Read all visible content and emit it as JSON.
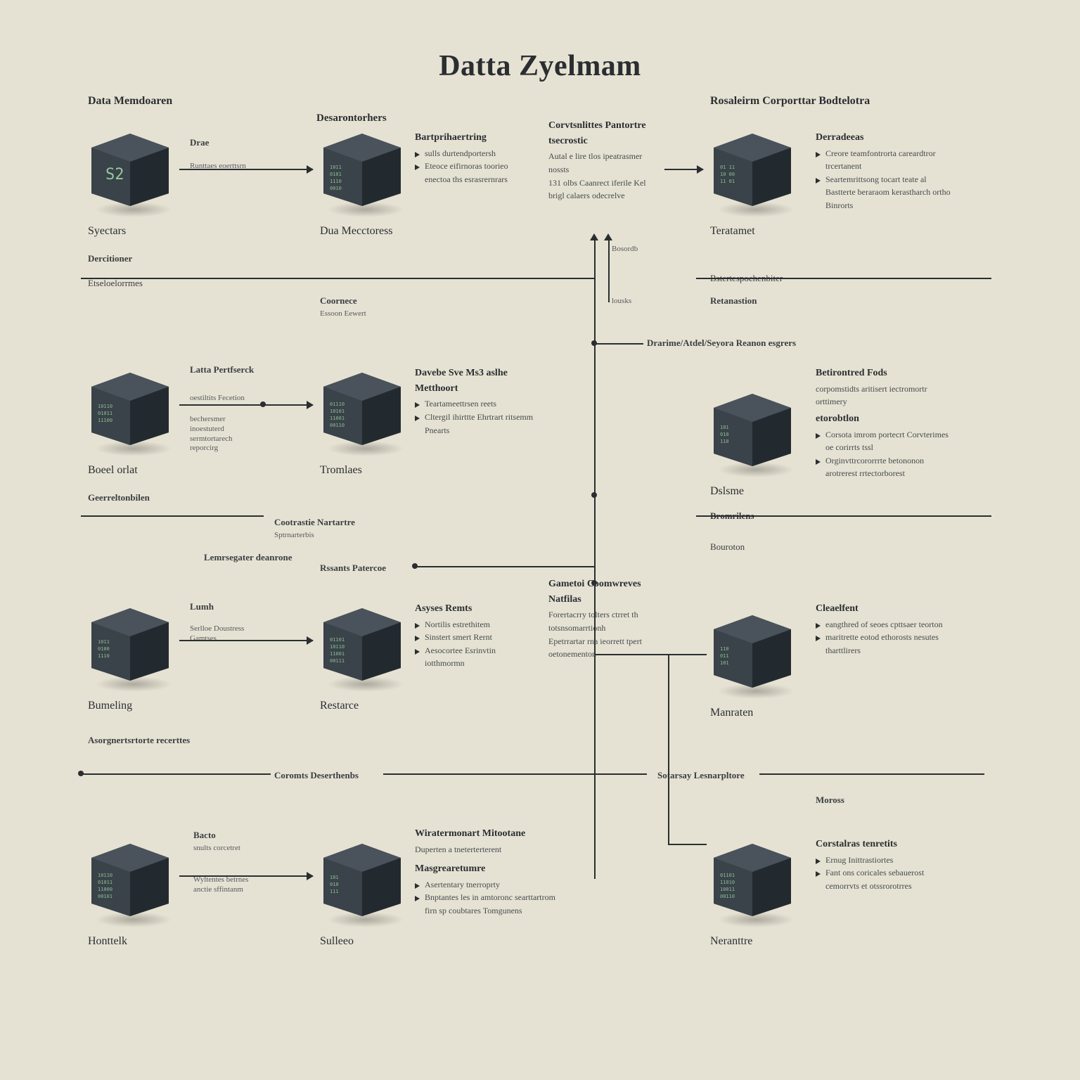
{
  "title": "Datta Zyelmam",
  "headers": {
    "h1": "Data Memdoaren",
    "h2": "Desarontorhers",
    "h3": "Rosaleirm Corporttar Bodtelotra"
  },
  "cubes": {
    "c1": {
      "caption_top": "Drae",
      "caption_sub": "Runttaes eoerttsrn",
      "below": "Syectars",
      "face": "S2"
    },
    "c2": {
      "below": "Dua Mecctoress"
    },
    "c3": {
      "below": "Teratamet"
    },
    "c4": {
      "left_title": "Latta Pertfserck",
      "below": "Boeel orlat"
    },
    "c5": {
      "below": "Tromlaes"
    },
    "c6": {
      "below": "Dslsme"
    },
    "c7": {
      "below": "Bumeling",
      "left_title": "Lumh"
    },
    "c8": {
      "below": "Restarce"
    },
    "c9": {
      "below": "Manraten"
    },
    "c10": {
      "below": "Honttelk"
    },
    "c11": {
      "below": "Sulleeo"
    },
    "c12": {
      "below": "Neranttre"
    }
  },
  "info_blocks": {
    "b1": {
      "title": "Bartprihaertring",
      "lines": [
        "sulls durtendportersh",
        "Eteoce eifirnoras toorieo enectoa ths esrasrernrars"
      ]
    },
    "b2": {
      "title": "Corvtsnlittes Pantortre tsecrostic",
      "lines": [
        "Autal e lire tlos ipeatrasmer nossts",
        "131 olbs Caanrect iferile Kel brigl calaers odecrelve"
      ]
    },
    "b3": {
      "title": "Derradeeas",
      "lines": [
        "Creore teamfontrorta careardtror trcertanent",
        "Seartemrittsong tocart teate al Bastterte beraraom kerastharch ortho Binrorts"
      ]
    },
    "b4": {
      "title": "Davebe Sve Ms3 aslhe Metthoort",
      "lines": [
        "Teartameettrsen reets",
        "Cltergil ihirttte Ehrtrart ritsemm Pnearts"
      ]
    },
    "b5": {
      "title": "Betirontred Fods",
      "lines": [
        "corpomstidts aritisert iectromortr orttimery"
      ]
    },
    "b6": {
      "title": "etorobtlon",
      "lines": [
        "Corsota imrom portecrt Corvterimes oe corirrts tssl",
        "Orginvttrcororrrte betononon arotrerest rrtectorborest"
      ]
    },
    "b7": {
      "title": "Asyses Remts",
      "lines": [
        "Nortilis estrethitem",
        "Sinstert smert Rernt",
        "Aesocortee Esrinvtin iotthmormn"
      ]
    },
    "b8": {
      "title": "Gametoi Coomwreves Natfilas",
      "lines": [
        "Forertacrry tolters ctrret th totsnsomarrtionh",
        "Epetrrartar rna ieorrett tpert oetonementon"
      ]
    },
    "b9": {
      "title": "Cleaelfent",
      "lines": [
        "eangthred of seoes cpttsaer teorton",
        "maritrette eotod ethorosts nesutes tharttlirers"
      ]
    },
    "b10": {
      "title": "Wiratermonart Mitootane",
      "lines": [
        "Duperten a tneterterterent"
      ]
    },
    "b11": {
      "title": "Masgrearetumre",
      "lines": [
        "Asertentary tnerroprty",
        "Bnptantes les in amtoronc searttartrom firn sp coubtares Tomgunens"
      ]
    },
    "b12": {
      "title": "Corstalras tenretits",
      "lines": [
        "Ernug Inittrastiortes",
        "Fant ons coricales sebauerost cemorrvts et otssrorotrres"
      ]
    }
  },
  "section_labels": {
    "dercitoner": "Dercitioner",
    "etseloelorrmes": "Etseloelorrmes",
    "coornece": "Coornece",
    "sub_coornece": "Essoon Eewert",
    "bestespo": "Bstertespochenbiter",
    "retanastion": "Retanastion",
    "drarime": "Drarime/Atdel/Seyora Reanon esgrers",
    "geerreltion": "Geerreltonbilen",
    "cootrastie": "Cootrastie Nartartre",
    "sptrnarterbis": "Sptrnarterbis",
    "bromrilens": "Bromrilens",
    "bouroton": "Bouroton",
    "lemrsegater": "Lemrsegater deanrone",
    "rssants": "Rssants Patercoe",
    "asorgnerts": "Asorgnertsrtorte recerttes",
    "coromts": "Coromts Deserthenbs",
    "sotarsay": "Sotarsay Lesnarpltore",
    "moross": "Moross",
    "bosordb": "Bosordb",
    "lousks": "lousks",
    "bacto": "Bacto",
    "bacto_sub1": "snults corcetret",
    "bacto_sub2": "Wyltentes betrnes anctie sffintanm",
    "c4_sub1": "oestiltits Fecetion",
    "c4_sub2": "bechersmer inoestuterd sermtortarech reporcirg",
    "lumh_sub": "Serlloe Doustress Gamtses"
  }
}
